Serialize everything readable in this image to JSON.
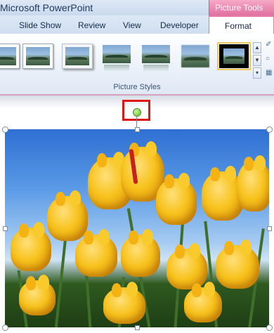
{
  "window": {
    "title": "Microsoft PowerPoint"
  },
  "contextual_tab": {
    "header": "Picture Tools"
  },
  "tabs": [
    {
      "label": "Slide Show"
    },
    {
      "label": "Review"
    },
    {
      "label": "View"
    },
    {
      "label": "Developer"
    },
    {
      "label": "Format",
      "selected": true
    }
  ],
  "ribbon": {
    "group_label": "Picture Styles",
    "gallery": [
      {
        "style": "simple-frame-white"
      },
      {
        "style": "simple-frame-white-2"
      },
      {
        "style": "drop-shadow-rectangle"
      },
      {
        "style": "reflected-rounded"
      },
      {
        "style": "reflected-rectangle"
      },
      {
        "style": "soft-edge"
      },
      {
        "style": "thick-black-frame",
        "selected": true
      }
    ]
  },
  "icons": {
    "gallery_up": "▲",
    "gallery_down": "▼",
    "gallery_more": "▾",
    "picture_border": "✐",
    "picture_effects": "○",
    "picture_layout": "▦"
  },
  "slide": {
    "picture_subject": "yellow tulips",
    "rotation_handle_highlight_color": "#e01515"
  }
}
